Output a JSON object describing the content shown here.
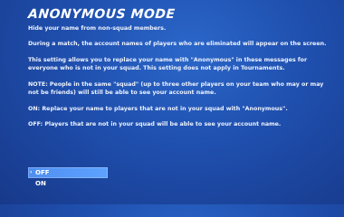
{
  "setting": {
    "title": "ANONYMOUS MODE",
    "paragraphs": [
      "Hide your name from non-squad members.",
      "During a match, the account names of players who are eliminated will appear on the screen.",
      "This setting allows you to replace your name with \"Anonymous\" in these messages for everyone who is not in your squad. This setting does not apply in Tournaments.",
      "NOTE: People in the same \"squad\" (up to three other players on your team who may or may not be friends) will still be able to see your account name.",
      "ON: Replace your name to players that are not in your squad with \"Anonymous\".",
      "OFF: Players that are not in your squad will be able to see your account name."
    ]
  },
  "options": {
    "items": [
      {
        "label": "OFF",
        "selected": true
      },
      {
        "label": "ON",
        "selected": false
      }
    ],
    "marker": "›"
  },
  "colors": {
    "background": "#1f4fae",
    "selected_option": "#5596f6",
    "text": "#ffffff"
  }
}
